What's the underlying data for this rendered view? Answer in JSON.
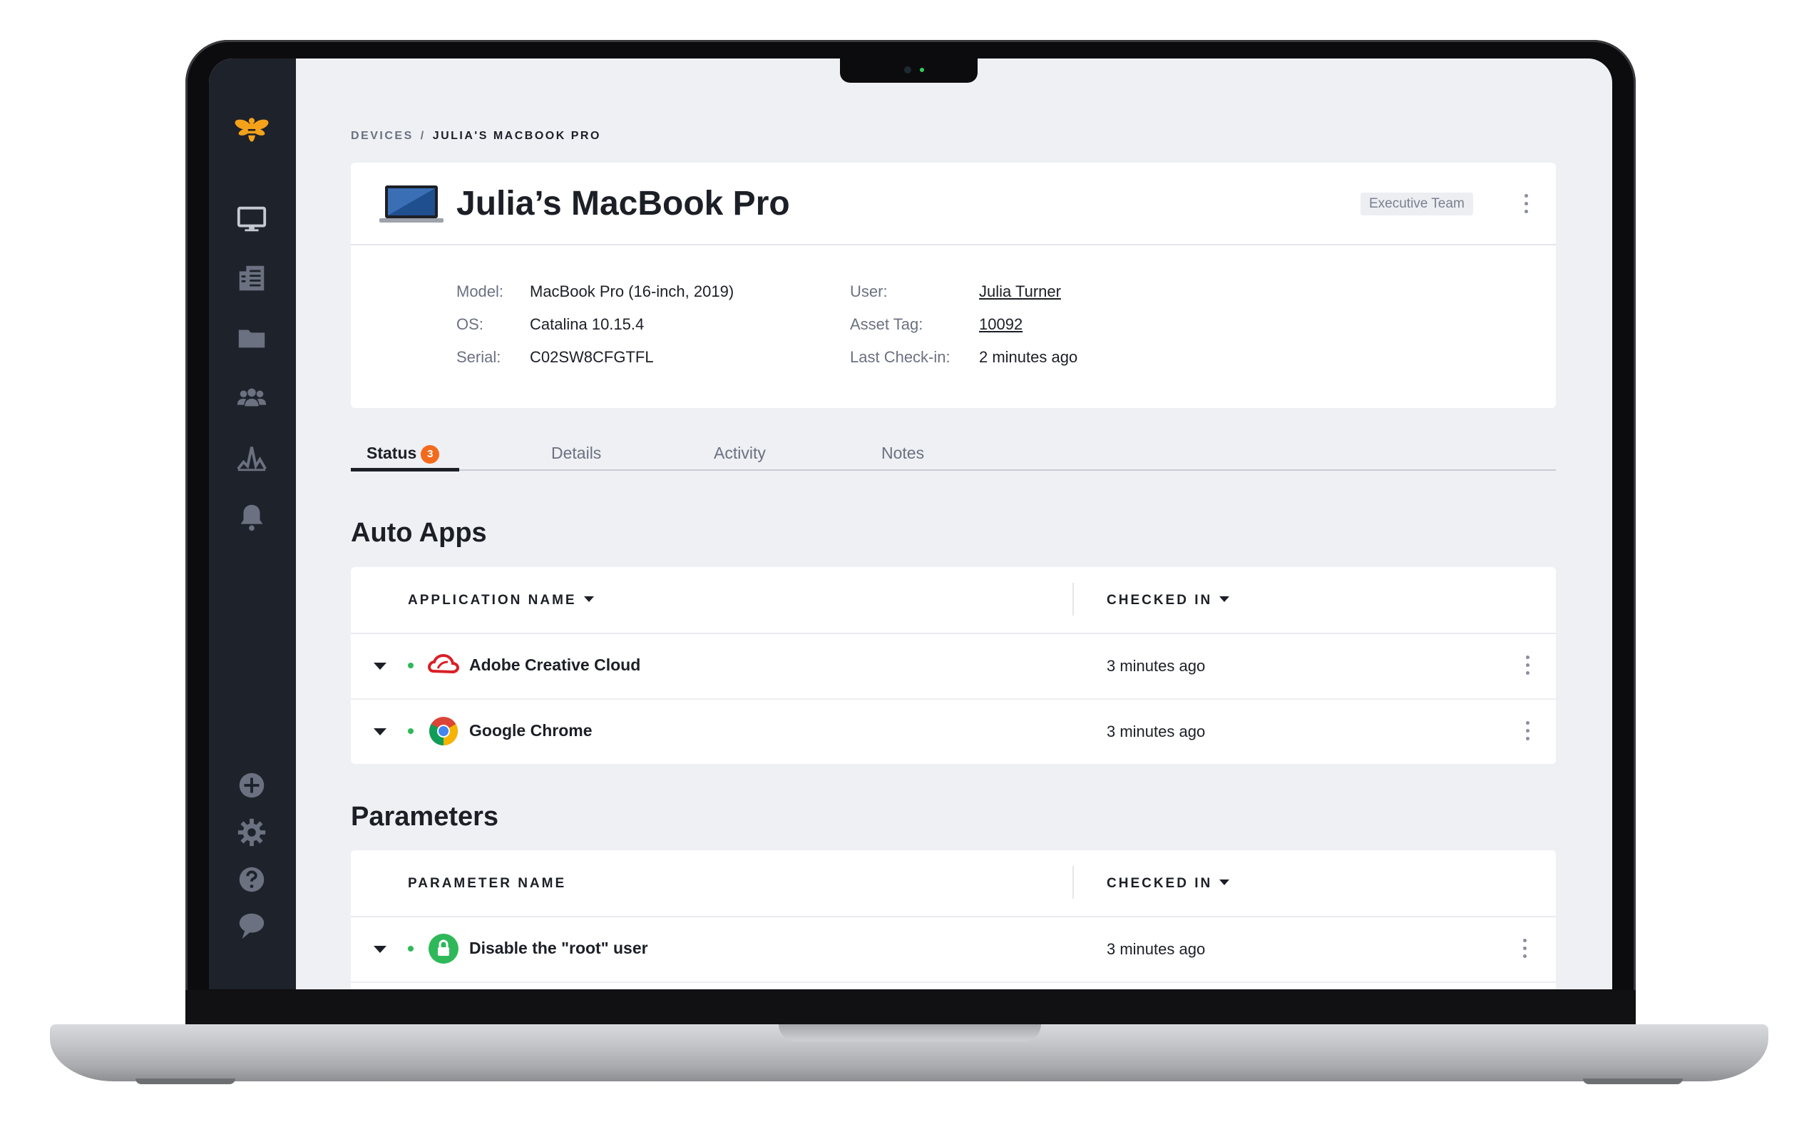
{
  "breadcrumb": {
    "root": "DEVICES",
    "separator": "/",
    "current": "JULIA'S MACBOOK PRO"
  },
  "device": {
    "name": "Julia’s MacBook Pro",
    "group_tag": "Executive Team",
    "fields": {
      "model_label": "Model:",
      "model": "MacBook Pro (16-inch, 2019)",
      "os_label": "OS:",
      "os": "Catalina 10.15.4",
      "serial_label": "Serial:",
      "serial": "C02SW8CFGTFL",
      "user_label": "User:",
      "user": "Julia Turner",
      "asset_label": "Asset Tag:",
      "asset": "10092",
      "checkin_label": "Last Check-in:",
      "checkin": "2 minutes ago"
    }
  },
  "tabs": [
    {
      "label": "Status",
      "badge": "3",
      "active": true
    },
    {
      "label": "Details"
    },
    {
      "label": "Activity"
    },
    {
      "label": "Notes"
    }
  ],
  "auto_apps": {
    "title": "Auto Apps",
    "col_name": "APPLICATION NAME",
    "col_checked": "CHECKED IN",
    "rows": [
      {
        "name": "Adobe Creative Cloud",
        "checked": "3 minutes ago",
        "icon": "adobe-creative-cloud-icon"
      },
      {
        "name": "Google Chrome",
        "checked": "3 minutes ago",
        "icon": "chrome-icon"
      }
    ]
  },
  "parameters": {
    "title": "Parameters",
    "col_name": "PARAMETER NAME",
    "col_checked": "CHECKED IN",
    "rows": [
      {
        "name": "Disable the \"root\" user",
        "checked": "3 minutes ago",
        "icon": "lock-icon"
      }
    ]
  },
  "colors": {
    "accent": "#f26b1d",
    "sidebar": "#1e222b",
    "status_ok": "#2fb85a",
    "brand": "#f5a21b"
  }
}
